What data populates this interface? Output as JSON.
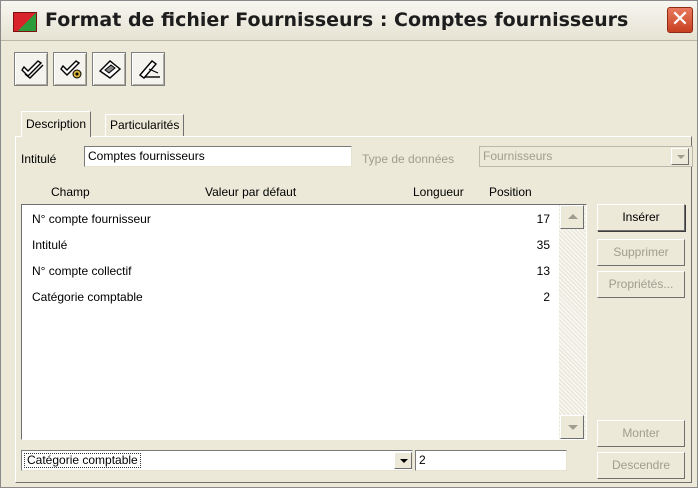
{
  "window": {
    "title": "Format de fichier Fournisseurs : Comptes fournisseurs",
    "close_glyph": "✕"
  },
  "toolbar": {
    "buttons": [
      {
        "icon": "checkmark-icon"
      },
      {
        "icon": "check-gear-icon"
      },
      {
        "icon": "eraser-icon"
      },
      {
        "icon": "pencil-edit-icon"
      }
    ]
  },
  "tabs": [
    {
      "label": "Description",
      "active": true
    },
    {
      "label": "Particularités",
      "active": false
    }
  ],
  "form": {
    "intitule_label": "Intitulé",
    "intitule_value": "Comptes fournisseurs",
    "type_label": "Type de données",
    "type_value": "Fournisseurs"
  },
  "list": {
    "columns": [
      "Champ",
      "Valeur par défaut",
      "Longueur",
      "Position"
    ],
    "rows": [
      {
        "champ": "N° compte fournisseur",
        "position": "17"
      },
      {
        "champ": "Intitulé",
        "position": "35"
      },
      {
        "champ": "N° compte collectif",
        "position": "13"
      },
      {
        "champ": "Catégorie comptable",
        "position": "2"
      }
    ]
  },
  "actions": {
    "inserer": "Insérer",
    "supprimer": "Supprimer",
    "proprietes": "Propriétés...",
    "monter": "Monter",
    "descendre": "Descendre"
  },
  "editor": {
    "field_select": "Catégorie comptable",
    "position_value": "2"
  },
  "colors": {
    "window_bg": "#ece9d8",
    "disabled_text": "#a09d90",
    "close_red": "#c8401f"
  }
}
